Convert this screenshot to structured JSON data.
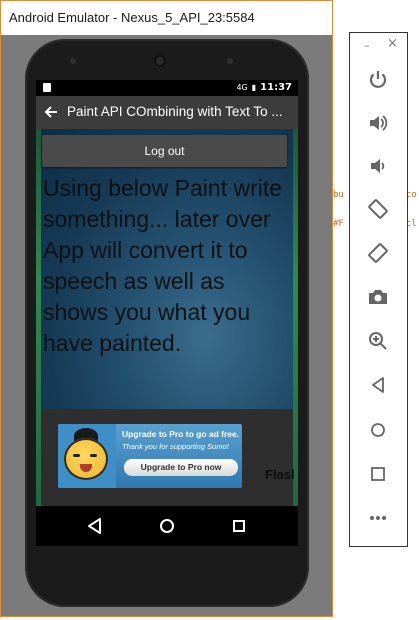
{
  "window": {
    "title": "Android Emulator - Nexus_5_API_23:5584"
  },
  "ide": {
    "snippet1": "bu",
    "snippet2": "co",
    "snippet3": "#F",
    "snippet4": "cl"
  },
  "statusbar": {
    "signal": "4G",
    "time": "11:37"
  },
  "appbar": {
    "title": "Paint API COmbining with Text To ..."
  },
  "content": {
    "logout_label": "Log out",
    "paint_text": "Using below Paint write something... later over App will convert it to speech as well as shows you what you have painted."
  },
  "ad": {
    "headline": "Upgrade to Pro to go ad free.",
    "subline": "Thank you for supporting Sumo!",
    "button_label": "Upgrade to Pro now"
  },
  "bottom": {
    "flash_label": "Flasl"
  },
  "toolbar": {
    "minimize": "–",
    "close": "×",
    "items": [
      "power-icon",
      "volume-up-icon",
      "volume-down-icon",
      "rotate-left-icon",
      "rotate-right-icon",
      "camera-icon",
      "zoom-icon",
      "back-icon",
      "home-icon",
      "overview-icon",
      "more-icon"
    ]
  },
  "colors": {
    "window_border": "#e08a3c",
    "appbar": "#3c3c3c",
    "ad_blue": "#2f78b2"
  }
}
